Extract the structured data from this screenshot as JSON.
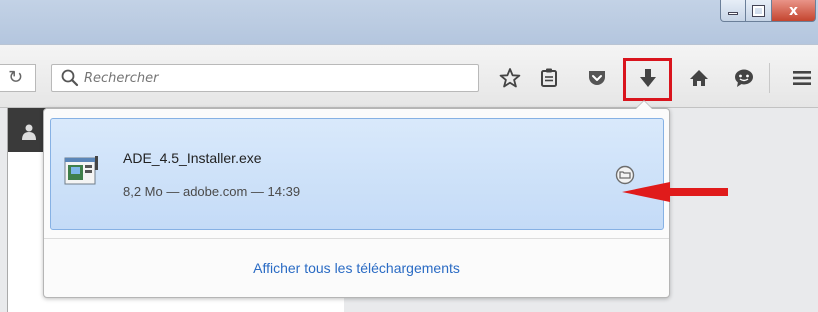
{
  "window": {
    "minimize_icon": "minimize-icon",
    "maximize_icon": "maximize-icon",
    "close_label": "x"
  },
  "toolbar": {
    "search_placeholder": "Rechercher",
    "icons": [
      "reload-icon",
      "search-icon",
      "bookmark-star-icon",
      "reading-list-icon",
      "pocket-icon",
      "download-icon",
      "home-icon",
      "chat-icon",
      "menu-icon"
    ]
  },
  "download_panel": {
    "item": {
      "file_name": "ADE_4.5_Installer.exe",
      "meta": "8,2 Mo — adobe.com — 14:39",
      "icon": "installer-file-icon",
      "action_icon": "open-file-icon"
    },
    "show_all_label": "Afficher tous les téléchargements"
  },
  "colors": {
    "highlight": "#d9141d",
    "item_bg": "#cfe2f9",
    "link": "#2a6bc4"
  }
}
